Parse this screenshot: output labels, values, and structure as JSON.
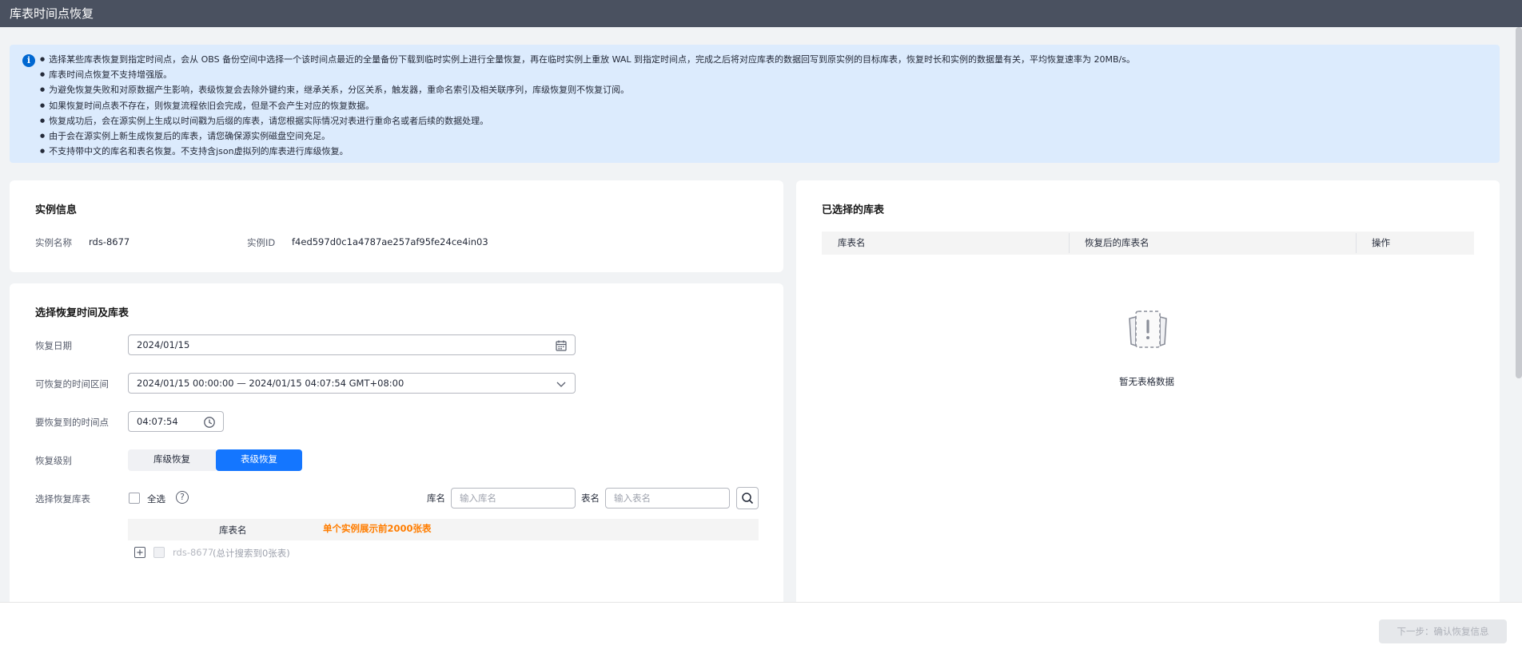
{
  "page_title": "库表时间点恢复",
  "notice": {
    "items": [
      "选择某些库表恢复到指定时间点，会从 OBS 备份空间中选择一个该时间点最近的全量备份下载到临时实例上进行全量恢复，再在临时实例上重放 WAL 到指定时间点，完成之后将对应库表的数据回写到原实例的目标库表，恢复时长和实例的数据量有关，平均恢复速率为 20MB/s。",
      "库表时间点恢复不支持增强版。",
      "为避免恢复失败和对原数据产生影响，表级恢复会去除外键约束，继承关系，分区关系，触发器，重命名索引及相关联序列，库级恢复则不恢复订阅。",
      "如果恢复时间点表不存在，则恢复流程依旧会完成，但是不会产生对应的恢复数据。",
      "恢复成功后，会在源实例上生成以时间戳为后缀的库表，请您根据实际情况对表进行重命名或者后续的数据处理。",
      "由于会在源实例上新生成恢复后的库表，请您确保源实例磁盘空间充足。",
      "不支持带中文的库名和表名恢复。不支持含json虚拟列的库表进行库级恢复。"
    ]
  },
  "instance_info": {
    "title": "实例信息",
    "name_label": "实例名称",
    "name_value": "rds-8677",
    "id_label": "实例ID",
    "id_value": "f4ed597d0c1a4787ae257af95fe24ce4in03"
  },
  "restore": {
    "title": "选择恢复时间及库表",
    "date_label": "恢复日期",
    "date_value": "2024/01/15",
    "range_label": "可恢复的时间区间",
    "range_value": "2024/01/15 00:00:00 — 2024/01/15 04:07:54 GMT+08:00",
    "time_label": "要恢复到的时间点",
    "time_value": "04:07:54",
    "level_label": "恢复级别",
    "level_options": [
      "库级恢复",
      "表级恢复"
    ],
    "level_selected": "表级恢复",
    "select_label": "选择恢复库表",
    "select_all": "全选",
    "db_label": "库名",
    "db_placeholder": "输入库名",
    "table_label": "表名",
    "table_placeholder": "输入表名",
    "col_header": "库表名",
    "col_note": "单个实例展示前2000张表",
    "row_name": "rds-8677",
    "row_count": "(总计搜索到0张表)"
  },
  "selected": {
    "title": "已选择的库表",
    "columns": [
      "库表名",
      "恢复后的库表名",
      "操作"
    ],
    "empty_text": "暂无表格数据"
  },
  "footer": {
    "next_label": "下一步：确认恢复信息"
  },
  "colors": {
    "primary": "#0067d1",
    "selected_button": "#1476ff",
    "warning_text": "#ff7d00",
    "notice_bg": "#dcebfd",
    "header_bg": "#4a5160"
  }
}
